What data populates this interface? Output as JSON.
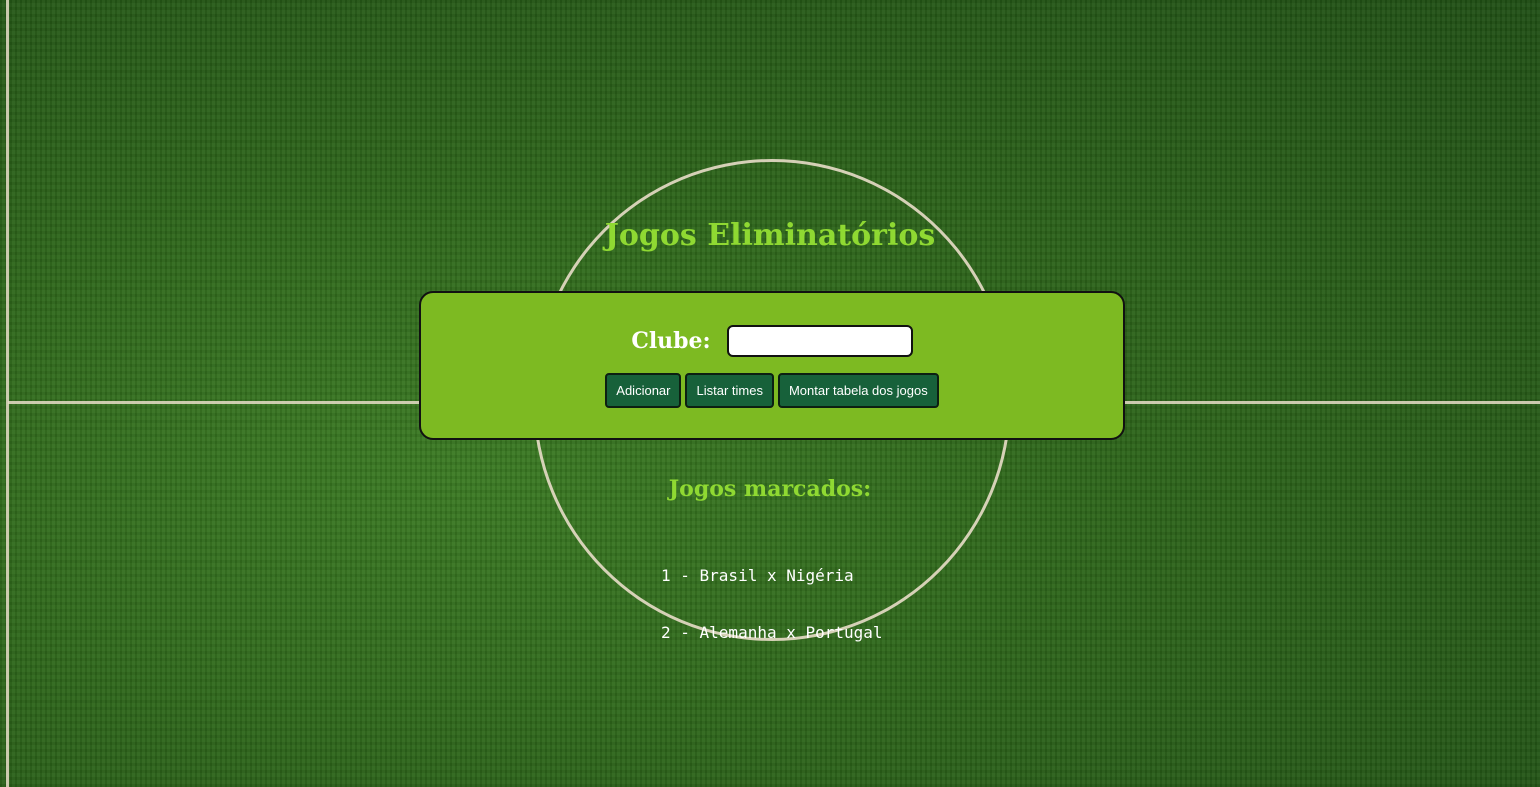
{
  "page": {
    "title": "Jogos Eliminatórios"
  },
  "form": {
    "club_label": "Clube:",
    "club_value": "",
    "buttons": {
      "add": "Adicionar",
      "list": "Listar times",
      "build": "Montar tabela dos jogos"
    }
  },
  "games": {
    "title": "Jogos marcados:",
    "items": [
      "1 - Brasil x Nigéria",
      "2 - Alemanha x Portugal"
    ]
  },
  "colors": {
    "accent": "#8fd932",
    "panel": "#7dba22",
    "button": "#17613a"
  },
  "background": "soccer-field-grass"
}
